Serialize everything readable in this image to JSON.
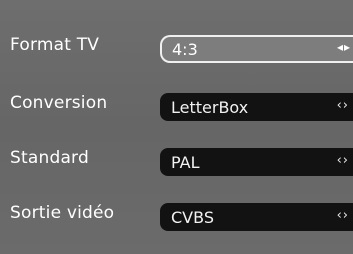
{
  "menu": {
    "items": [
      {
        "label": "Format TV",
        "value": "4:3",
        "arrows": "◂▸",
        "selected": true
      },
      {
        "label": "Conversion",
        "value": "LetterBox",
        "arrows": "‹›",
        "selected": false
      },
      {
        "label": "Standard",
        "value": "PAL",
        "arrows": "‹›",
        "selected": false
      },
      {
        "label": "Sortie vidéo",
        "value": "CVBS",
        "arrows": "‹›",
        "selected": false
      }
    ]
  },
  "colors": {
    "background": "#6a6a6a",
    "field_background": "#121212",
    "selected_field_background": "#7d7d7d",
    "text": "#ffffff"
  },
  "icons": {
    "selected_arrows": "left-right-triangle-arrows-icon",
    "field_arrows": "left-right-chevron-icon"
  }
}
